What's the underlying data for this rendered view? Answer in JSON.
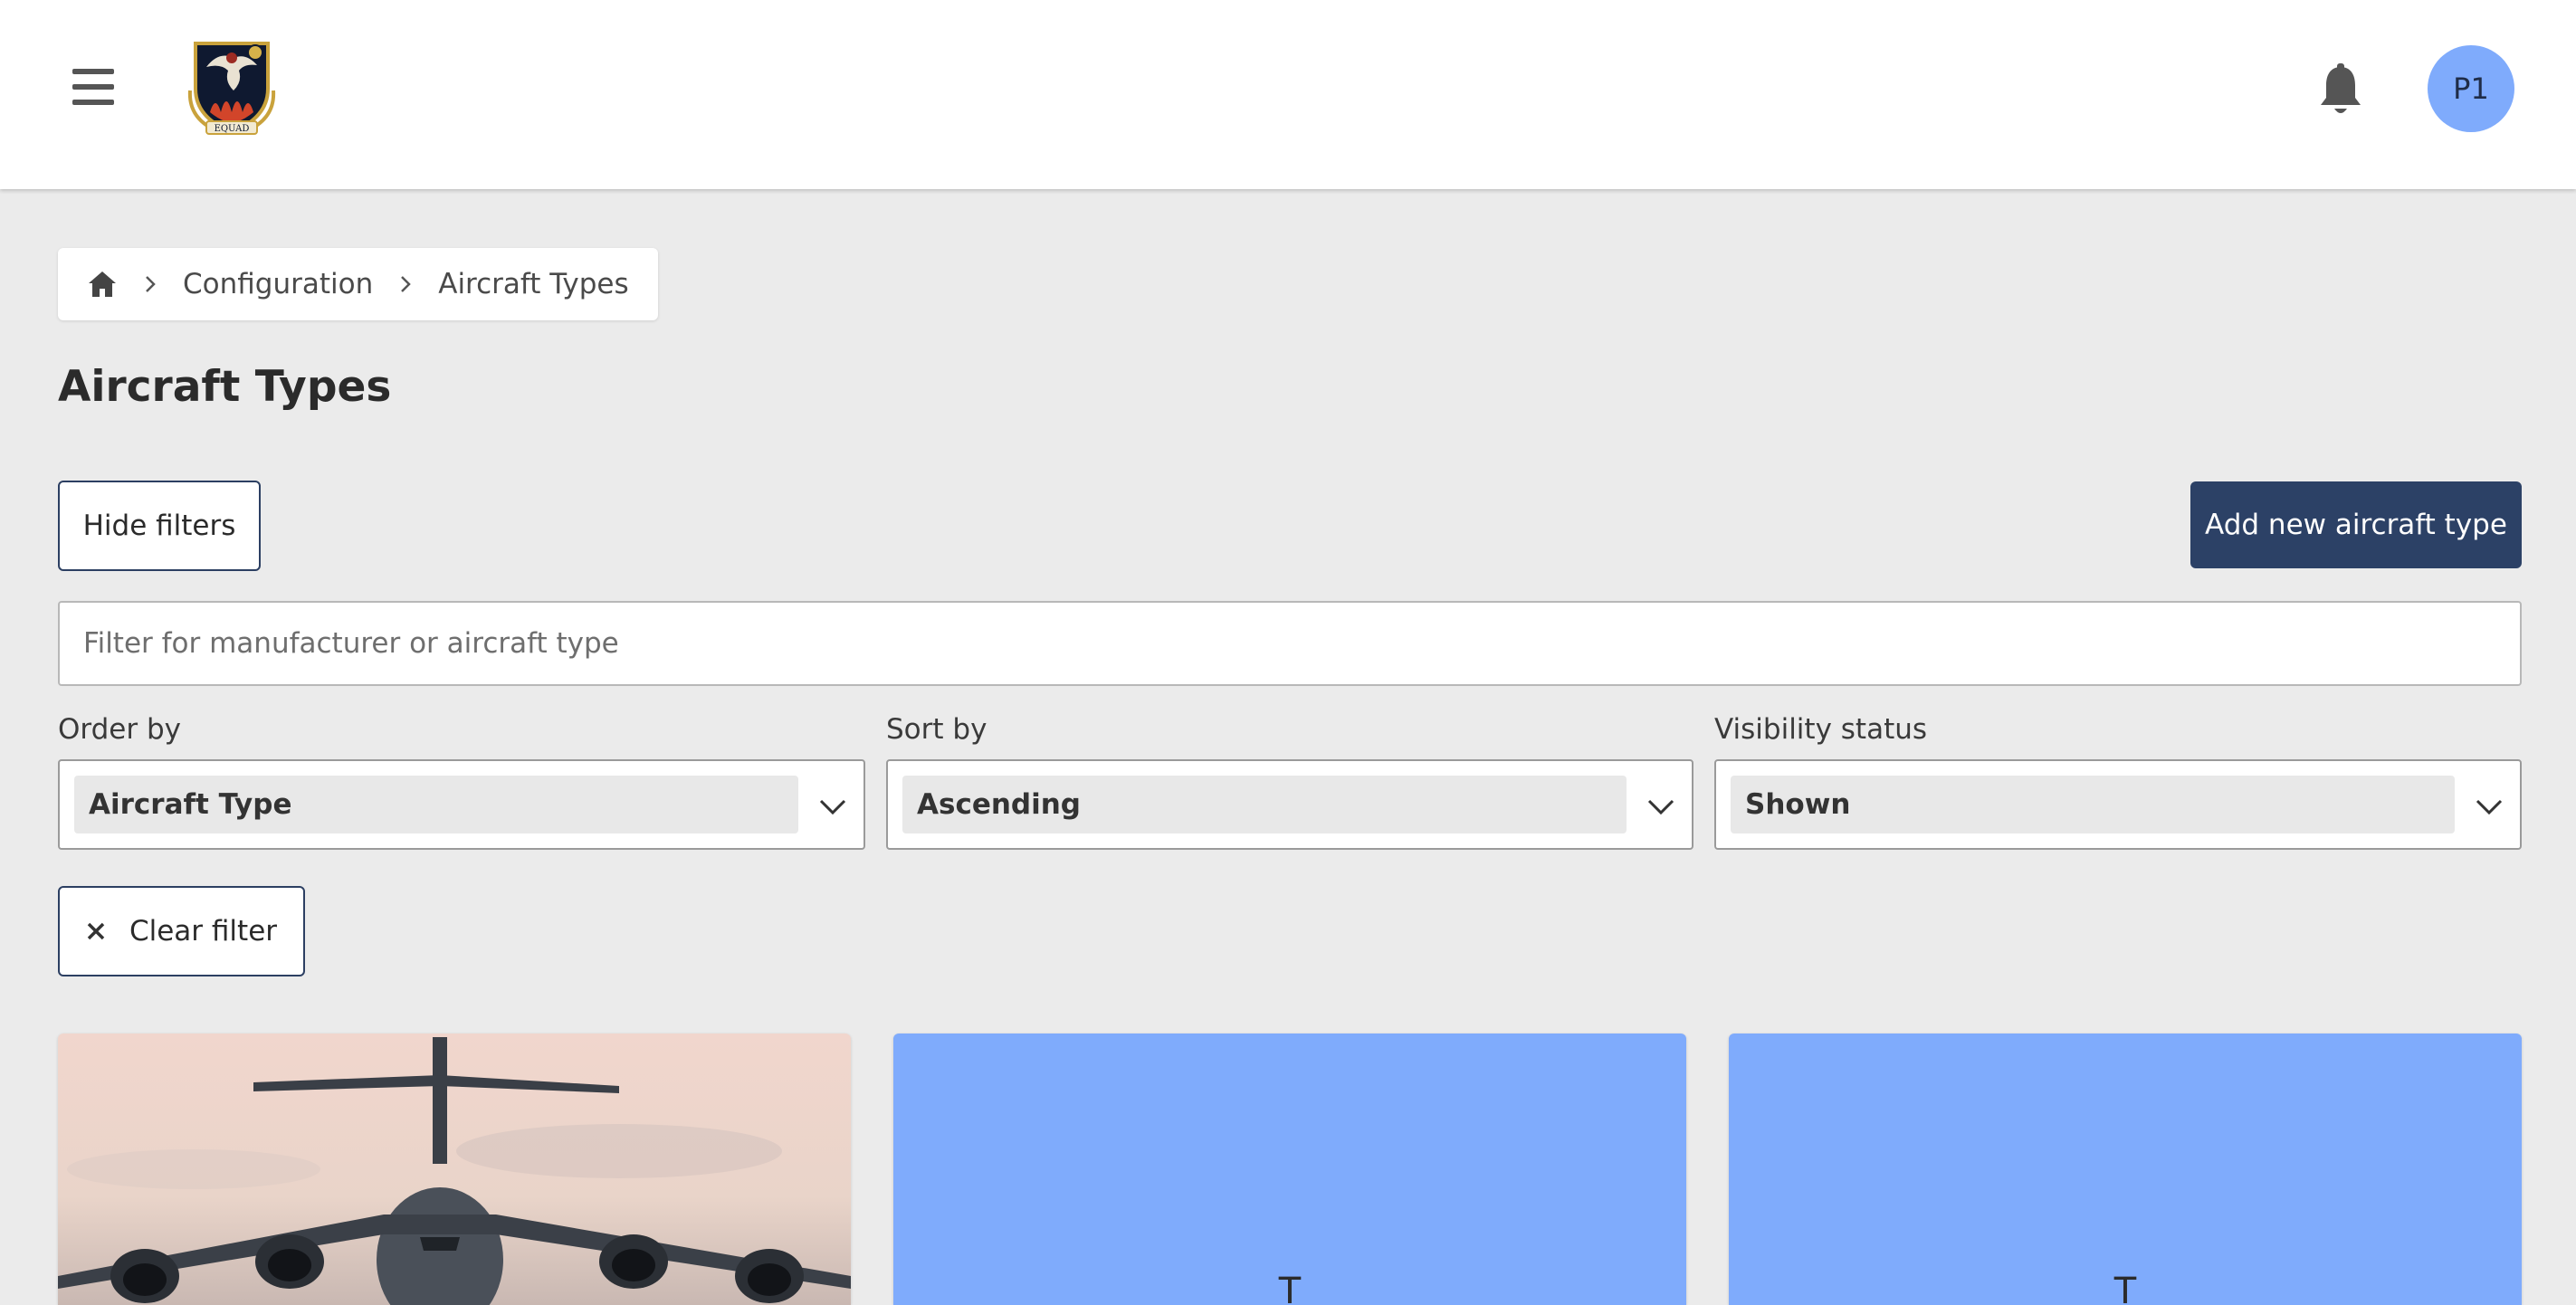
{
  "header": {
    "menu_icon": "hamburger-menu-icon",
    "logo_text": "EQUAD",
    "notification_icon": "bell-icon",
    "avatar_initials": "P1",
    "avatar_color": "#7fabfc"
  },
  "breadcrumb": {
    "home_icon": "home-icon",
    "items": [
      "Configuration",
      "Aircraft Types"
    ]
  },
  "page": {
    "title": "Aircraft Types"
  },
  "toolbar": {
    "hide_filters_label": "Hide filters",
    "add_label": "Add new aircraft type",
    "add_color": "#2c4166"
  },
  "filters": {
    "search_placeholder": "Filter for manufacturer or aircraft type",
    "search_value": "",
    "order_by": {
      "label": "Order by",
      "value": "Aircraft Type"
    },
    "sort_by": {
      "label": "Sort by",
      "value": "Ascending"
    },
    "visibility": {
      "label": "Visibility status",
      "value": "Shown"
    },
    "clear_label": "Clear filter"
  },
  "cards": [
    {
      "kind": "photo",
      "image": "cargo-aircraft-photo"
    },
    {
      "kind": "placeholder",
      "letter": "T",
      "color": "#7fabfc"
    },
    {
      "kind": "placeholder",
      "letter": "T",
      "color": "#7fabfc"
    }
  ]
}
